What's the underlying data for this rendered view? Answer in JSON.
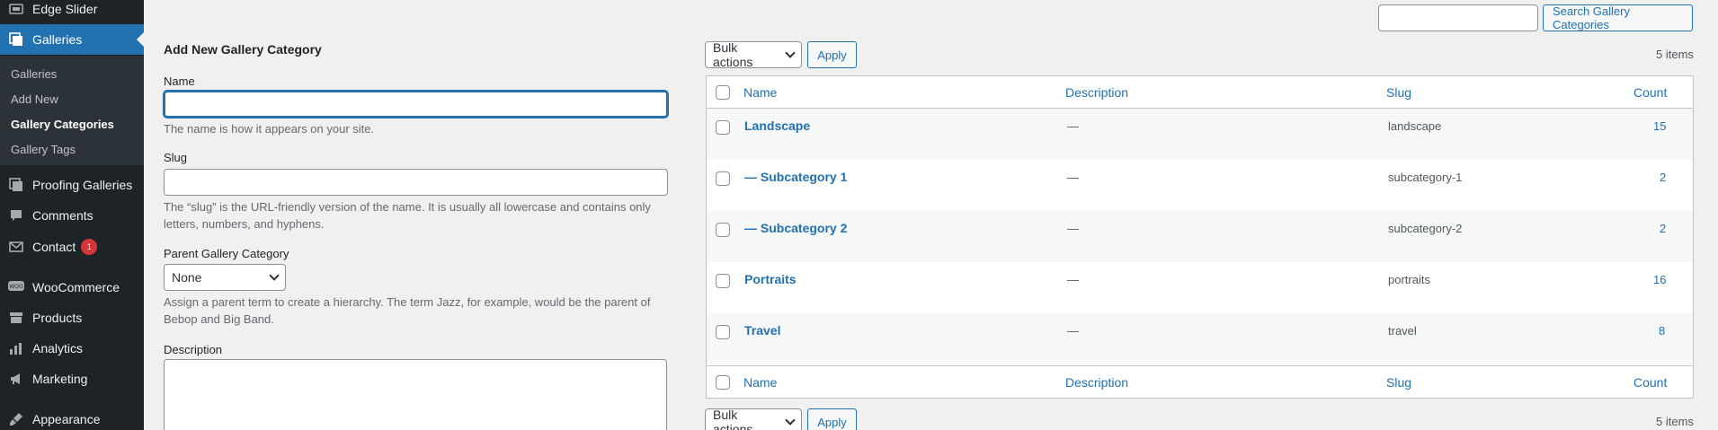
{
  "sidebar": {
    "items": [
      {
        "label": "Edge Slider",
        "icon": "slider-icon"
      },
      {
        "label": "Galleries",
        "icon": "gallery-icon"
      },
      {
        "label": "Proofing Galleries",
        "icon": "gallery-icon"
      },
      {
        "label": "Comments",
        "icon": "comment-icon"
      },
      {
        "label": "Contact",
        "icon": "mail-icon",
        "badge": "1"
      },
      {
        "label": "WooCommerce",
        "icon": "woo-icon"
      },
      {
        "label": "Products",
        "icon": "archive-icon"
      },
      {
        "label": "Analytics",
        "icon": "bar-chart-icon"
      },
      {
        "label": "Marketing",
        "icon": "megaphone-icon"
      },
      {
        "label": "Appearance",
        "icon": "brush-icon"
      }
    ],
    "submenu": [
      "Galleries",
      "Add New",
      "Gallery Categories",
      "Gallery Tags"
    ],
    "accent": "#2271b1"
  },
  "search": {
    "button": "Search Gallery Categories",
    "value": ""
  },
  "form": {
    "title": "Add New Gallery Category",
    "name_label": "Name",
    "name_hint": "The name is how it appears on your site.",
    "slug_label": "Slug",
    "slug_hint_1": "The “slug” is the URL-friendly version of the name. It is usually all lowercase and contains only",
    "slug_hint_2": "letters, numbers, and hyphens.",
    "parent_label": "Parent Gallery Category",
    "parent_value": "None",
    "parent_hint_1": "Assign a parent term to create a hierarchy. The term Jazz, for example, would be the parent of",
    "parent_hint_2": "Bebop and Big Band.",
    "description_label": "Description"
  },
  "table": {
    "bulk_label": "Bulk actions",
    "apply_label": "Apply",
    "items_count": "5 items",
    "columns": {
      "name": "Name",
      "description": "Description",
      "slug": "Slug",
      "count": "Count"
    },
    "rows": [
      {
        "name": "Landscape",
        "description": "—",
        "slug": "landscape",
        "count": "15"
      },
      {
        "name": "— Subcategory 1",
        "description": "—",
        "slug": "subcategory-1",
        "count": "2"
      },
      {
        "name": "— Subcategory 2",
        "description": "—",
        "slug": "subcategory-2",
        "count": "2"
      },
      {
        "name": "Portraits",
        "description": "—",
        "slug": "portraits",
        "count": "16"
      },
      {
        "name": "Travel",
        "description": "—",
        "slug": "travel",
        "count": "8"
      }
    ]
  }
}
